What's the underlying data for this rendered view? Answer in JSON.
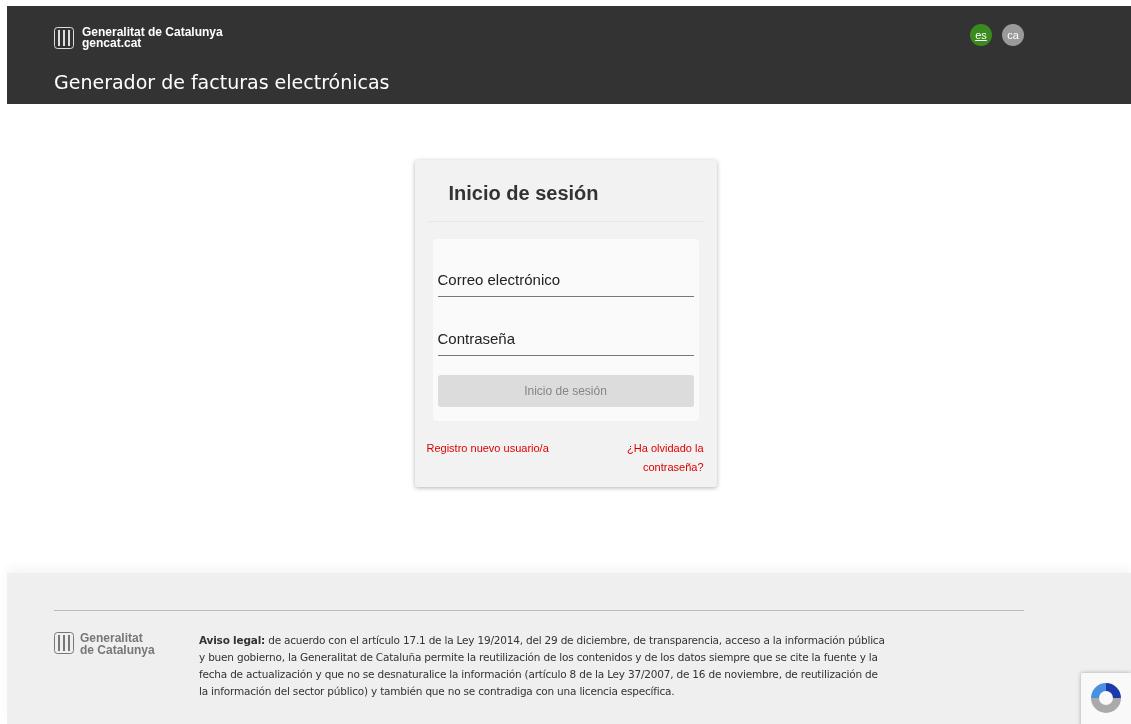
{
  "header": {
    "logo_name": "Generalitat de Catalunya",
    "logo_domain": "gencat.cat",
    "app_title": "Generador de facturas electrónicas",
    "languages": [
      {
        "label": "es",
        "selected": true
      },
      {
        "label": "ca",
        "selected": false
      }
    ]
  },
  "login": {
    "title": "Inicio de sesión",
    "fields": [
      {
        "placeholder": "Correo electrónico"
      },
      {
        "placeholder": "Contraseña"
      }
    ],
    "submit": {
      "label": "Inicio de sesión",
      "disabled": true
    },
    "register_link": "Registro nuevo usuario/a",
    "forgot_link": "¿Ha olvidado la contraseña?"
  },
  "footer": {
    "logo_lines": [
      "Generalitat",
      "de Catalunya"
    ],
    "legal": "**Aviso legal:** de acuerdo con el artículo 17.1 de la Ley 19/2014, del 29 de diciembre, de transparencia, acceso a la información pública y buen gobierno, la Generalitat de Cataluña permite la reutilización de los contenidos y de los datos siempre que se cite la fuente y la fecha de actualización y que no se desnaturalice la información (artículo 8 de la Ley 37/2007, de 16 de noviembre, de reutilización de la información del sector público) y también que no se contradiga con una licencia específica."
  }
}
